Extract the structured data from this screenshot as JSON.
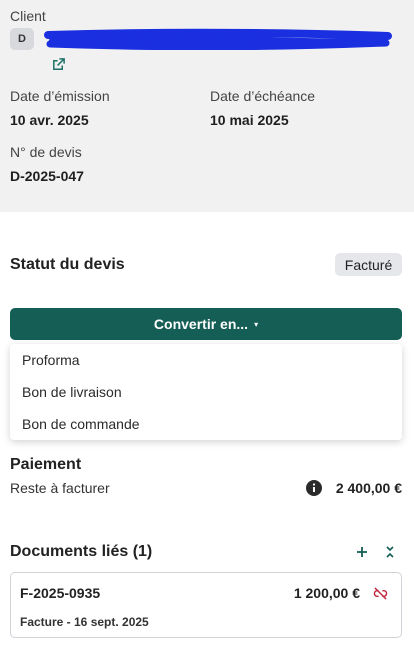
{
  "client": {
    "label": "Client",
    "avatar_initial": "D",
    "name_redacted": true,
    "link_icon": "external-link-icon"
  },
  "dates": {
    "emission_label": "Date d’émission",
    "emission_value": "10 avr. 2025",
    "echeance_label": "Date d’échéance",
    "echeance_value": "10 mai 2025"
  },
  "devis": {
    "number_label": "N° de devis",
    "number_value": "D-2025-047"
  },
  "status": {
    "title": "Statut du devis",
    "badge": "Facturé"
  },
  "convert": {
    "button_label": "Convertir en...",
    "caret": "▾",
    "menu_items": [
      "Proforma",
      "Bon de livraison",
      "Bon de commande"
    ]
  },
  "payment": {
    "title": "Paiement",
    "remaining_label": "Reste à facturer",
    "remaining_amount": "2 400,00 €",
    "info_icon": "info-icon"
  },
  "linked_documents": {
    "title": "Documents liés (1)",
    "add_icon": "plus-icon",
    "collapse_icon": "collapse-icon",
    "items": [
      {
        "number": "F-2025-0935",
        "amount": "1 200,00 €",
        "subtitle": "Facture - 16 sept. 2025",
        "unlink_icon": "unlink-icon"
      }
    ]
  },
  "colors": {
    "primary": "#155e56",
    "header_bg": "#f1f1f1",
    "redaction": "#1a2fe0",
    "unlink": "#c0243c"
  }
}
